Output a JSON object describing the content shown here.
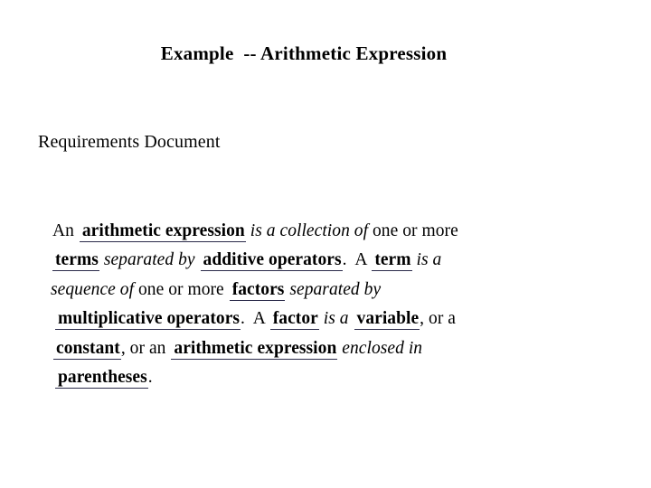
{
  "slide": {
    "title": "Example  -- Arithmetic Expression",
    "section_heading": "Requirements Document",
    "colors": {
      "background": "#ffffff",
      "text": "#000000",
      "underline": "#2b2b4a"
    },
    "body": {
      "lines": [
        {
          "runs": [
            {
              "style": "reg",
              "text": "An "
            },
            {
              "style": "term",
              "text": "arithmetic expression"
            },
            {
              "style": "ital",
              "text": " is a collection of"
            },
            {
              "style": "reg",
              "text": " one or more"
            }
          ]
        },
        {
          "runs": [
            {
              "style": "term",
              "text": "terms"
            },
            {
              "style": "ital",
              "text": " separated by "
            },
            {
              "style": "term",
              "text": "additive operators"
            },
            {
              "style": "reg",
              "text": ".  A "
            },
            {
              "style": "term",
              "text": "term"
            },
            {
              "style": "ital",
              "text": " is a"
            }
          ]
        },
        {
          "runs": [
            {
              "style": "ital",
              "text": "sequence of"
            },
            {
              "style": "reg",
              "text": " one or more "
            },
            {
              "style": "term",
              "text": "factors"
            },
            {
              "style": "ital",
              "text": " separated by"
            }
          ]
        },
        {
          "runs": [
            {
              "style": "term",
              "text": "multiplicative operators"
            },
            {
              "style": "reg",
              "text": ".  A "
            },
            {
              "style": "term",
              "text": "factor"
            },
            {
              "style": "ital",
              "text": " is a "
            },
            {
              "style": "term",
              "text": "variable"
            },
            {
              "style": "reg",
              "text": ", or a"
            }
          ]
        },
        {
          "runs": [
            {
              "style": "term",
              "text": "constant"
            },
            {
              "style": "reg",
              "text": ", or an "
            },
            {
              "style": "term",
              "text": "arithmetic expression"
            },
            {
              "style": "ital",
              "text": " enclosed in"
            }
          ]
        },
        {
          "runs": [
            {
              "style": "term",
              "text": "parentheses"
            },
            {
              "style": "reg",
              "text": "."
            }
          ]
        }
      ]
    }
  }
}
